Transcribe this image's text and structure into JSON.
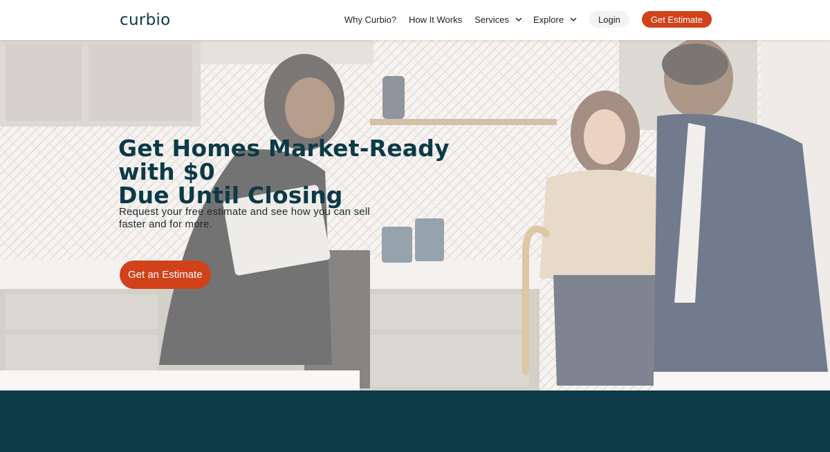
{
  "brand": {
    "logo_text": "curbio"
  },
  "nav": {
    "items": [
      {
        "label": "Why Curbio?"
      },
      {
        "label": "How It Works"
      },
      {
        "label": "Services"
      },
      {
        "label": "Explore"
      }
    ],
    "login_label": "Login",
    "cta_label": "Get Estimate"
  },
  "hero": {
    "title_line1": "Get Homes Market-Ready with $0",
    "title_line2": "Due Until Closing",
    "subtitle": "Request your free estimate and see how you can sell faster and for more.",
    "cta_label": "Get an Estimate"
  },
  "colors": {
    "brand_dark": "#0c3a47",
    "accent": "#d1411a",
    "login_bg": "#f3f3f3"
  },
  "icons": [
    "chevron-down-icon"
  ]
}
